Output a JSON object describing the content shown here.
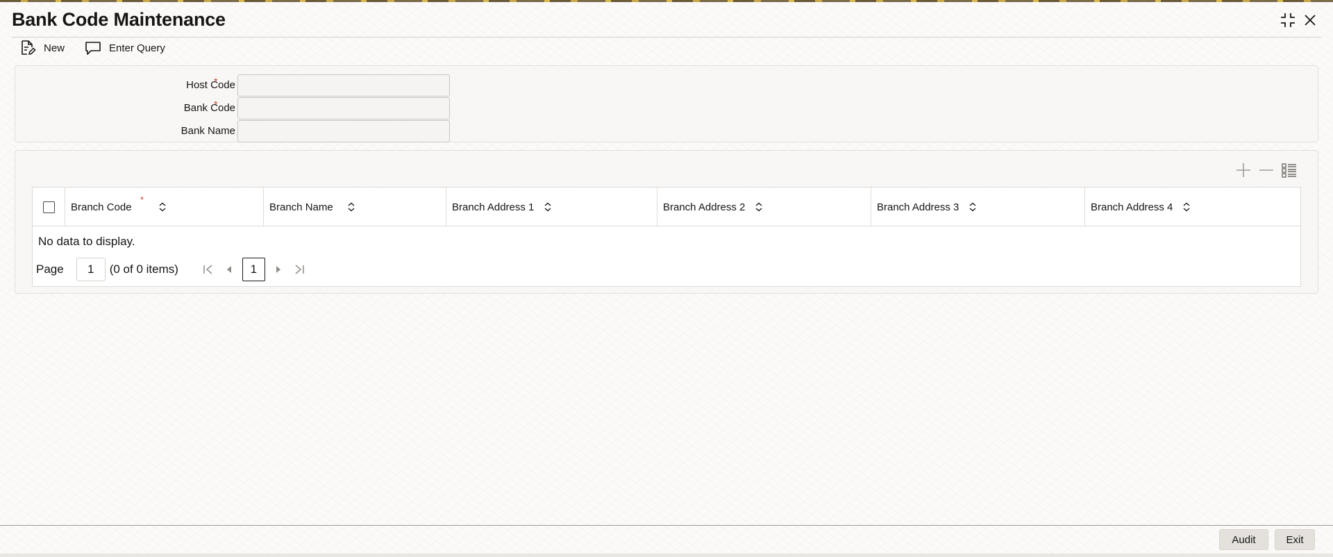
{
  "window": {
    "title": "Bank Code Maintenance"
  },
  "toolbar": {
    "new_label": "New",
    "enter_query_label": "Enter Query"
  },
  "form": {
    "host_code": {
      "label": "Host Code",
      "required": "*",
      "value": ""
    },
    "bank_code": {
      "label": "Bank Code",
      "required": "*",
      "value": ""
    },
    "bank_name": {
      "label": "Bank Name",
      "value": ""
    }
  },
  "grid": {
    "columns": [
      {
        "label": "Branch Code",
        "required": "*"
      },
      {
        "label": "Branch Name"
      },
      {
        "label": "Branch Address 1"
      },
      {
        "label": "Branch Address 2"
      },
      {
        "label": "Branch Address 3"
      },
      {
        "label": "Branch Address 4"
      }
    ],
    "empty_message": "No data to display.",
    "pager": {
      "page_label": "Page",
      "page_value": "1",
      "count_text": "(0 of 0 items)",
      "current_page": "1"
    }
  },
  "footer": {
    "audit_label": "Audit",
    "exit_label": "Exit"
  },
  "colors": {
    "required": "#c74634",
    "text": "#161513",
    "panel": "#f7f6f4"
  }
}
